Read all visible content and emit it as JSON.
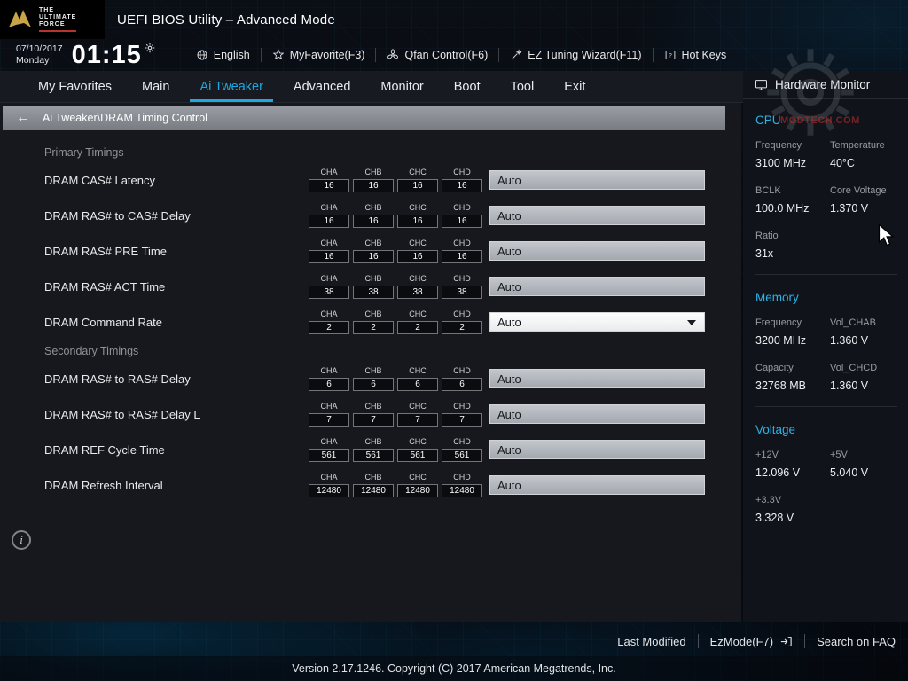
{
  "colors": {
    "accent": "#1fa8e0",
    "hw_title": "#2bb2e6"
  },
  "logo": {
    "line1": "THE",
    "line2": "ULTIMATE",
    "line3": "FORCE"
  },
  "header": {
    "title": "UEFI BIOS Utility – Advanced Mode",
    "date": "07/10/2017",
    "day": "Monday",
    "time": "01:15",
    "toolbar": [
      {
        "icon": "globe-icon",
        "label": "English"
      },
      {
        "icon": "myfavorite-icon",
        "label": "MyFavorite(F3)"
      },
      {
        "icon": "qfan-icon",
        "label": "Qfan Control(F6)"
      },
      {
        "icon": "ez-tuning-icon",
        "label": "EZ Tuning Wizard(F11)"
      },
      {
        "icon": "hotkeys-icon",
        "label": "Hot Keys"
      }
    ]
  },
  "nav": {
    "tabs": [
      {
        "label": "My Favorites",
        "active": false
      },
      {
        "label": "Main",
        "active": false
      },
      {
        "label": "Ai Tweaker",
        "active": true
      },
      {
        "label": "Advanced",
        "active": false
      },
      {
        "label": "Monitor",
        "active": false
      },
      {
        "label": "Boot",
        "active": false
      },
      {
        "label": "Tool",
        "active": false
      },
      {
        "label": "Exit",
        "active": false
      }
    ]
  },
  "breadcrumb": {
    "path": "Ai Tweaker\\DRAM Timing Control"
  },
  "channels": [
    "CHA",
    "CHB",
    "CHC",
    "CHD"
  ],
  "settings": {
    "sections": [
      {
        "title": "Primary Timings",
        "rows": [
          {
            "label": "DRAM CAS# Latency",
            "values": [
              "16",
              "16",
              "16",
              "16"
            ],
            "setting": "Auto",
            "dropdown": false
          },
          {
            "label": "DRAM RAS# to CAS# Delay",
            "values": [
              "16",
              "16",
              "16",
              "16"
            ],
            "setting": "Auto",
            "dropdown": false
          },
          {
            "label": "DRAM RAS# PRE Time",
            "values": [
              "16",
              "16",
              "16",
              "16"
            ],
            "setting": "Auto",
            "dropdown": false
          },
          {
            "label": "DRAM RAS# ACT Time",
            "values": [
              "38",
              "38",
              "38",
              "38"
            ],
            "setting": "Auto",
            "dropdown": false
          },
          {
            "label": "DRAM Command Rate",
            "values": [
              "2",
              "2",
              "2",
              "2"
            ],
            "setting": "Auto",
            "dropdown": true
          }
        ]
      },
      {
        "title": "Secondary Timings",
        "rows": [
          {
            "label": "DRAM RAS# to RAS# Delay",
            "values": [
              "6",
              "6",
              "6",
              "6"
            ],
            "setting": "Auto",
            "dropdown": false
          },
          {
            "label": "DRAM RAS# to RAS# Delay L",
            "values": [
              "7",
              "7",
              "7",
              "7"
            ],
            "setting": "Auto",
            "dropdown": false
          },
          {
            "label": "DRAM REF Cycle Time",
            "values": [
              "561",
              "561",
              "561",
              "561"
            ],
            "setting": "Auto",
            "dropdown": false
          },
          {
            "label": "DRAM Refresh Interval",
            "values": [
              "12480",
              "12480",
              "12480",
              "12480"
            ],
            "setting": "Auto",
            "dropdown": false
          }
        ]
      }
    ]
  },
  "hardware_monitor": {
    "title": "Hardware Monitor",
    "groups": [
      {
        "title": "CPU",
        "metrics": [
          {
            "label": "Frequency",
            "value": "3100 MHz"
          },
          {
            "label": "Temperature",
            "value": "40°C"
          },
          {
            "label": "BCLK",
            "value": "100.0 MHz"
          },
          {
            "label": "Core Voltage",
            "value": "1.370 V"
          },
          {
            "label": "Ratio",
            "value": "31x"
          }
        ]
      },
      {
        "title": "Memory",
        "metrics": [
          {
            "label": "Frequency",
            "value": "3200 MHz"
          },
          {
            "label": "Vol_CHAB",
            "value": "1.360 V"
          },
          {
            "label": "Capacity",
            "value": "32768 MB"
          },
          {
            "label": "Vol_CHCD",
            "value": "1.360 V"
          }
        ]
      },
      {
        "title": "Voltage",
        "metrics": [
          {
            "label": "+12V",
            "value": "12.096 V"
          },
          {
            "label": "+5V",
            "value": "5.040 V"
          },
          {
            "label": "+3.3V",
            "value": "3.328 V"
          }
        ]
      }
    ]
  },
  "bottom_bar": {
    "last_modified": "Last Modified",
    "ezmode": "EzMode(F7)",
    "search": "Search on FAQ"
  },
  "footer": {
    "version": "Version 2.17.1246. Copyright (C) 2017 American Megatrends, Inc."
  },
  "watermark": {
    "text": "MODTECH.COM"
  }
}
